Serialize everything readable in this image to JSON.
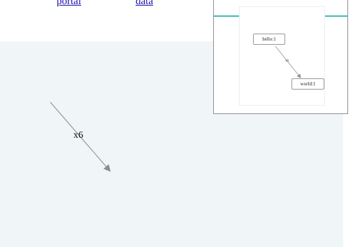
{
  "nav": {
    "link_portal": "portal",
    "link_data": "data"
  },
  "graph": {
    "edge_label": "x6",
    "edge_color": "#8c8c8c",
    "canvas_background": "#f0f5f8"
  },
  "minimap": {
    "node_hello": "hello:1",
    "node_world": "world:1",
    "edge_label": "x6",
    "accent_color": "#3dbfb5"
  }
}
